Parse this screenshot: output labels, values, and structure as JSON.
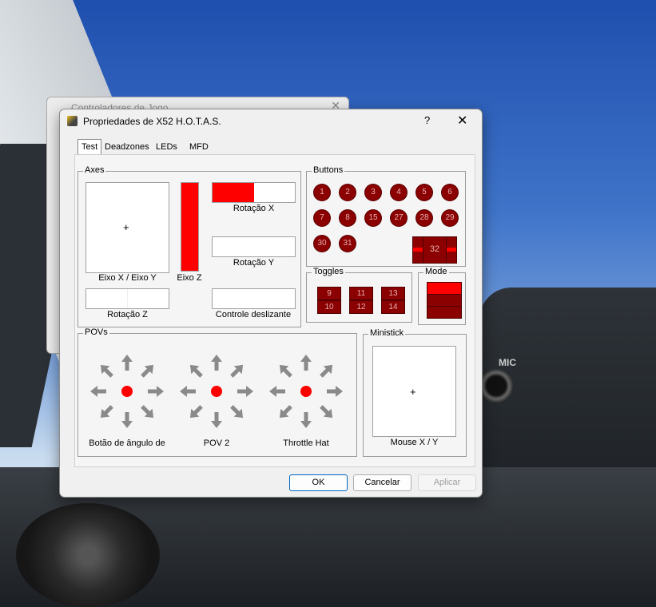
{
  "background_window": {
    "title": "Controladores de Jogo"
  },
  "dialog": {
    "title": "Propriedades de X52 H.O.T.A.S.",
    "help": "?",
    "close": "✕"
  },
  "tabs": [
    {
      "label": "Test",
      "active": true
    },
    {
      "label": "Deadzones"
    },
    {
      "label": "LEDs"
    },
    {
      "label": "MFD"
    }
  ],
  "axes": {
    "group": "Axes",
    "xy_label": "Eixo X / Eixo Y",
    "z_label": "Eixo Z",
    "rx_label": "Rotação X",
    "ry_label": "Rotação Y",
    "rz_label": "Rotação Z",
    "slider_label": "Controle deslizante",
    "z_fill": 1.0,
    "rx_fill": 0.5
  },
  "buttons": {
    "group": "Buttons",
    "row1": [
      "1",
      "2",
      "3",
      "4",
      "5",
      "6"
    ],
    "row2": [
      "7",
      "8",
      "15",
      "27",
      "28",
      "29"
    ],
    "row3": [
      "30",
      "31"
    ],
    "big": "32"
  },
  "toggles": {
    "group": "Toggles",
    "top": [
      "9",
      "11",
      "13"
    ],
    "bottom": [
      "10",
      "12",
      "14"
    ]
  },
  "mode": {
    "group": "Mode",
    "active_index": 0
  },
  "povs": {
    "group": "POVs",
    "labels": [
      "Botão de ângulo de",
      "POV 2",
      "Throttle Hat"
    ]
  },
  "ministick": {
    "group": "Ministick",
    "label": "Mouse X / Y"
  },
  "footer": {
    "ok": "OK",
    "cancel": "Cancelar",
    "apply": "Aplicar"
  },
  "background_labels": {
    "mic": "MIC"
  },
  "colors": {
    "active_red": "#ff0000",
    "inactive_red": "#8b0000",
    "accent": "#0067c0"
  }
}
